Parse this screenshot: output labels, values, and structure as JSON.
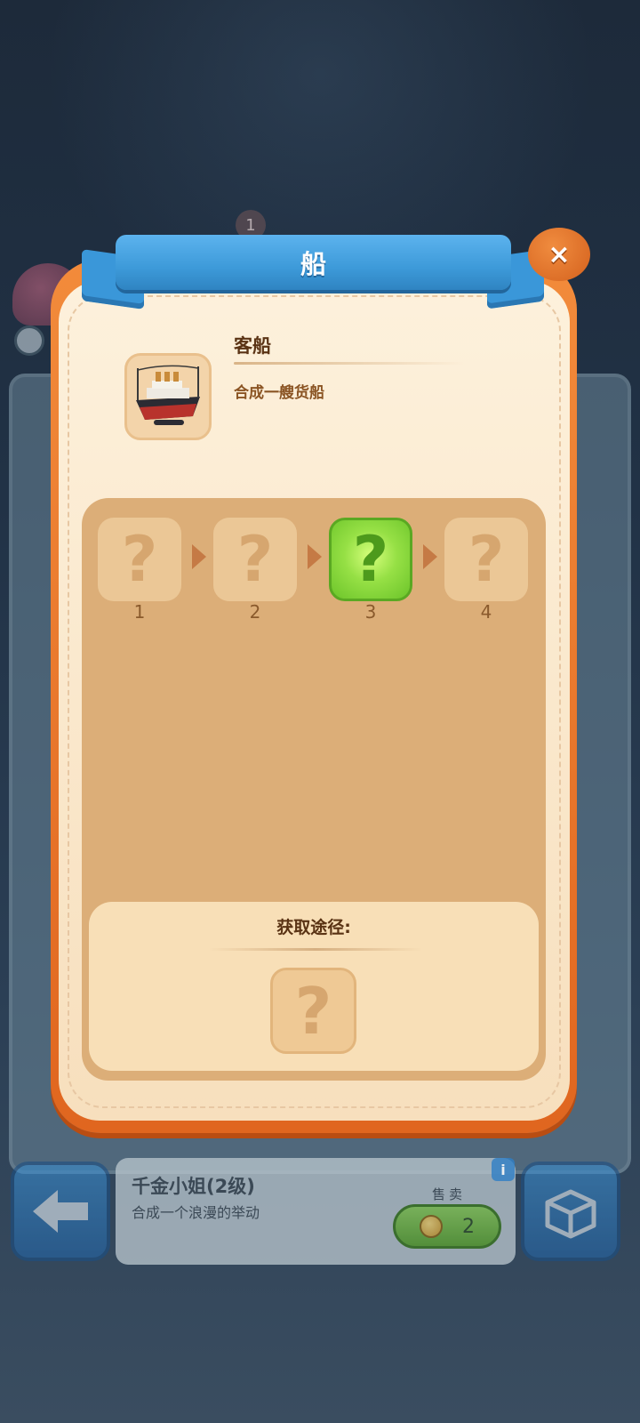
{
  "background": {
    "stack_badge": "1"
  },
  "dialog": {
    "title": "船",
    "close_symbol": "×",
    "item": {
      "name": "客船",
      "description": "合成一艘货船",
      "icon": "cruise-ship-icon"
    },
    "evolution": {
      "placeholder_symbol": "?",
      "steps": [
        {
          "label": "1",
          "active": false
        },
        {
          "label": "2",
          "active": false
        },
        {
          "label": "3",
          "active": true
        },
        {
          "label": "4",
          "active": false
        }
      ]
    },
    "acquire": {
      "title": "获取途径:",
      "placeholder_symbol": "?"
    }
  },
  "bottom_bar": {
    "item_title": "千金小姐(2级)",
    "item_desc": "合成一个浪漫的举动",
    "sell_label": "售卖",
    "sell_price": "2",
    "info_symbol": "i"
  },
  "colors": {
    "ribbon": "#3d9ad9",
    "dialog_frame": "#e0661f",
    "active_step": "#96e045",
    "panel": "#dcae78"
  }
}
